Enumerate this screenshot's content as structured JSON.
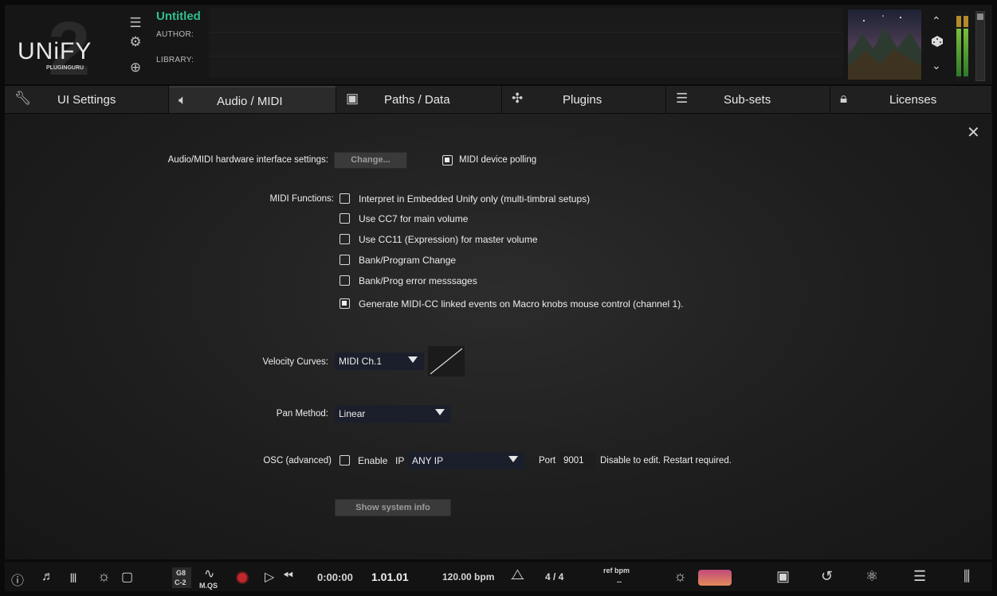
{
  "header": {
    "logo_text": "UNiFY",
    "logo_sub": "PLUGINGURU",
    "logo_number": "2",
    "title": "Untitled",
    "author_label": "AUTHOR:",
    "library_label": "LIBRARY:"
  },
  "tabs": [
    {
      "label": "UI Settings",
      "icon": "wrench-icon"
    },
    {
      "label": "Audio / MIDI",
      "icon": "speaker-icon",
      "active": true
    },
    {
      "label": "Paths / Data",
      "icon": "floppy-icon"
    },
    {
      "label": "Plugins",
      "icon": "puzzle-icon"
    },
    {
      "label": "Sub-sets",
      "icon": "list-icon"
    },
    {
      "label": "Licenses",
      "icon": "lock-icon"
    }
  ],
  "settings": {
    "hardware_label": "Audio/MIDI hardware interface settings:",
    "change_button": "Change...",
    "midi_polling": {
      "label": "MIDI device polling",
      "checked": true
    },
    "midi_functions_label": "MIDI Functions:",
    "midi_functions": [
      {
        "label": "Interpret in Embedded Unify only (multi-timbral setups)",
        "checked": false
      },
      {
        "label": "Use CC7 for main volume",
        "checked": false
      },
      {
        "label": "Use CC11 (Expression) for master volume",
        "checked": false
      },
      {
        "label": "Bank/Program Change",
        "checked": false
      },
      {
        "label": "Bank/Prog error messsages",
        "checked": false
      },
      {
        "label": "Generate MIDI-CC linked events on Macro knobs mouse control (channel 1).",
        "checked": true
      }
    ],
    "velocity_label": "Velocity Curves:",
    "velocity_value": "MIDI Ch.1",
    "pan_label": "Pan Method:",
    "pan_value": "Linear",
    "osc_label": "OSC (advanced)",
    "osc_enable_label": "Enable",
    "osc_ip_label": "IP",
    "osc_ip_value": "ANY IP",
    "osc_port_label": "Port",
    "osc_port_value": "9001",
    "osc_note": "Disable to edit. Restart required.",
    "sysinfo_button": "Show system info"
  },
  "footer": {
    "note_hi": "G8",
    "note_lo": "C-2",
    "mqs": "M.QS",
    "time": "0:00:00",
    "position": "1.01.01",
    "tempo": "120.00 bpm",
    "signature": "4 / 4",
    "ref_bpm_label": "ref bpm",
    "ref_bpm_value": "--"
  },
  "colors": {
    "accent_green": "#2fbf8a",
    "record_red": "#c0282b",
    "dropdown_bg": "#1a1f2b"
  }
}
